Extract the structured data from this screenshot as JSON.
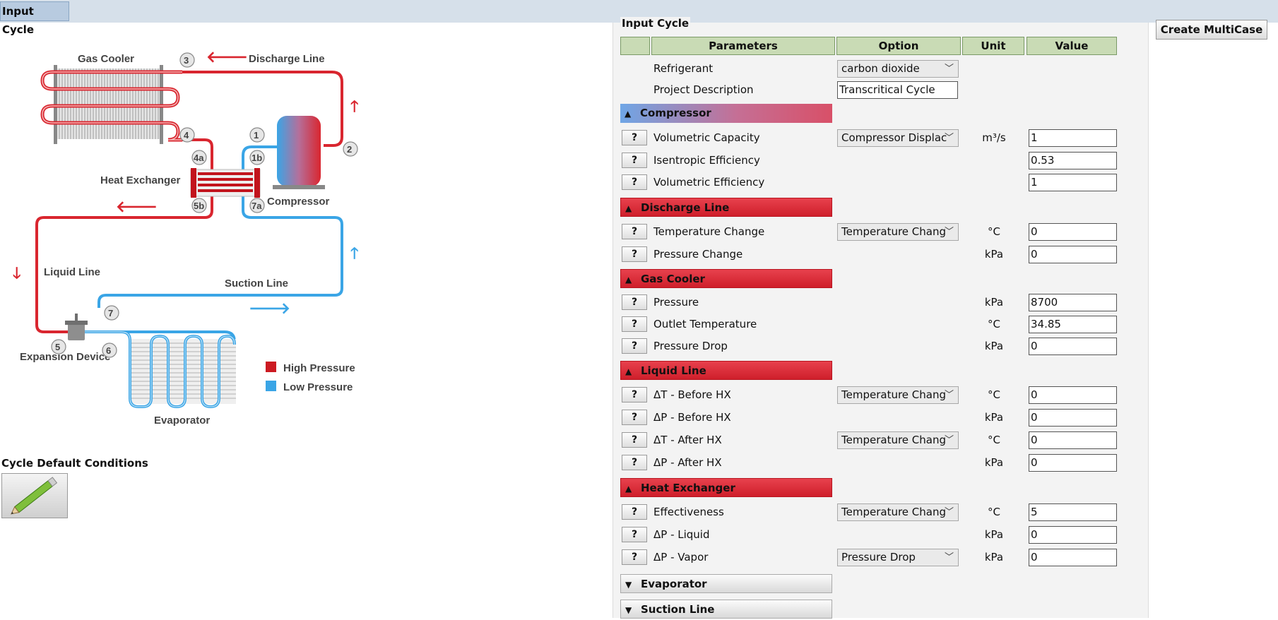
{
  "tab": {
    "label": "Input Cycle"
  },
  "diagram": {
    "labels": {
      "gas_cooler": "Gas Cooler",
      "discharge_line": "Discharge Line",
      "heat_exchanger": "Heat Exchanger",
      "compressor": "Compressor",
      "liquid_line": "Liquid Line",
      "suction_line": "Suction Line",
      "expansion_device": "Expansion Device",
      "evaporator": "Evaporator"
    },
    "points": {
      "p3": "3",
      "p4": "4",
      "p1": "1",
      "p2": "2",
      "p4a": "4a",
      "p1b": "1b",
      "p5b": "5b",
      "p7a": "7a",
      "p7": "7",
      "p5": "5",
      "p6": "6"
    },
    "legend": {
      "high": "High Pressure",
      "low": "Low Pressure",
      "high_color": "#cc1a22",
      "low_color": "#3aa5e6"
    }
  },
  "cycle_default": {
    "title": "Cycle Default Conditions"
  },
  "panel": {
    "title": "Input Cycle",
    "headers": {
      "parameters": "Parameters",
      "option": "Option",
      "unit": "Unit",
      "value": "Value"
    },
    "refrigerant": {
      "label": "Refrigerant",
      "option": "carbon dioxide"
    },
    "project": {
      "label": "Project Description",
      "value": "Transcritical Cycle"
    },
    "sections": {
      "compressor": "Compressor",
      "discharge": "Discharge Line",
      "gas_cooler": "Gas Cooler",
      "liquid": "Liquid Line",
      "hx": "Heat Exchanger",
      "evaporator": "Evaporator",
      "suction": "Suction Line"
    },
    "help": "?",
    "rows": {
      "vol_cap": {
        "label": "Volumetric Capacity",
        "option": "Compressor Displac",
        "unit": "m³/s",
        "value": "1"
      },
      "isen_eff": {
        "label": "Isentropic Efficiency",
        "value": "0.53"
      },
      "vol_eff": {
        "label": "Volumetric Efficiency",
        "value": "1"
      },
      "dl_temp": {
        "label": "Temperature Change",
        "option": "Temperature Chang",
        "unit": "°C",
        "value": "0"
      },
      "dl_press": {
        "label": "Pressure Change",
        "unit": "kPa",
        "value": "0"
      },
      "gc_press": {
        "label": "Pressure",
        "unit": "kPa",
        "value": "8700"
      },
      "gc_outlet": {
        "label": "Outlet Temperature",
        "unit": "°C",
        "value": "34.85"
      },
      "gc_drop": {
        "label": "Pressure Drop",
        "unit": "kPa",
        "value": "0"
      },
      "ll_dt_before": {
        "label": "ΔT - Before HX",
        "option": "Temperature Chang",
        "unit": "°C",
        "value": "0"
      },
      "ll_dp_before": {
        "label": "ΔP - Before HX",
        "unit": "kPa",
        "value": "0"
      },
      "ll_dt_after": {
        "label": "ΔT - After HX",
        "option": "Temperature Chang",
        "unit": "°C",
        "value": "0"
      },
      "ll_dp_after": {
        "label": "ΔP - After HX",
        "unit": "kPa",
        "value": "0"
      },
      "hx_eff": {
        "label": "Effectiveness",
        "option": "Temperature Chang",
        "unit": "°C",
        "value": "5"
      },
      "hx_dp_liq": {
        "label": "ΔP - Liquid",
        "unit": "kPa",
        "value": "0"
      },
      "hx_dp_vap": {
        "label": "ΔP - Vapor",
        "option": "Pressure Drop",
        "unit": "kPa",
        "value": "0"
      }
    }
  },
  "multicase": {
    "label": "Create MultiCase"
  }
}
